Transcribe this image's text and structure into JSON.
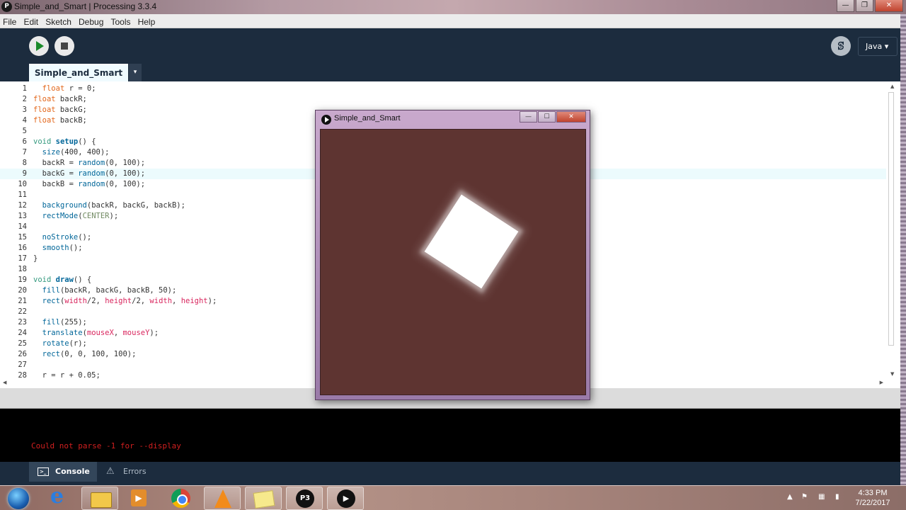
{
  "window": {
    "title": "Simple_and_Smart | Processing 3.3.4"
  },
  "menu": [
    "File",
    "Edit",
    "Sketch",
    "Debug",
    "Tools",
    "Help"
  ],
  "toolbar": {
    "mode": "Java ▾"
  },
  "tab": {
    "name": "Simple_and_Smart",
    "menu_arrow": "▾"
  },
  "editor": {
    "highlighted_line": 9,
    "lines": [
      {
        "n": "1",
        "code": "  float r = 0;"
      },
      {
        "n": "2",
        "code": "float backR;"
      },
      {
        "n": "3",
        "code": "float backG;"
      },
      {
        "n": "4",
        "code": "float backB;"
      },
      {
        "n": "5",
        "code": ""
      },
      {
        "n": "6",
        "code": "void setup() {"
      },
      {
        "n": "7",
        "code": "  size(400, 400);"
      },
      {
        "n": "8",
        "code": "  backR = random(0, 100);"
      },
      {
        "n": "9",
        "code": "  backG = random(0, 100);"
      },
      {
        "n": "10",
        "code": "  backB = random(0, 100);"
      },
      {
        "n": "11",
        "code": ""
      },
      {
        "n": "12",
        "code": "  background(backR, backG, backB);"
      },
      {
        "n": "13",
        "code": "  rectMode(CENTER);"
      },
      {
        "n": "14",
        "code": ""
      },
      {
        "n": "15",
        "code": "  noStroke();"
      },
      {
        "n": "16",
        "code": "  smooth();"
      },
      {
        "n": "17",
        "code": "}"
      },
      {
        "n": "18",
        "code": ""
      },
      {
        "n": "19",
        "code": "void draw() {"
      },
      {
        "n": "20",
        "code": "  fill(backR, backG, backB, 50);"
      },
      {
        "n": "21",
        "code": "  rect(width/2, height/2, width, height);"
      },
      {
        "n": "22",
        "code": ""
      },
      {
        "n": "23",
        "code": "  fill(255);"
      },
      {
        "n": "24",
        "code": "  translate(mouseX, mouseY);"
      },
      {
        "n": "25",
        "code": "  rotate(r);"
      },
      {
        "n": "26",
        "code": "  rect(0, 0, 100, 100);"
      },
      {
        "n": "27",
        "code": ""
      },
      {
        "n": "28",
        "code": "  r = r + 0.05;"
      }
    ]
  },
  "console": {
    "message": "Could not parse -1 for --display"
  },
  "console_tabs": {
    "console": "Console",
    "errors": "Errors"
  },
  "sketch_window": {
    "title": "Simple_and_Smart",
    "background": "#5e3431",
    "square_color": "#ffffff"
  },
  "taskbar": {
    "items": [
      "Start",
      "Internet Explorer",
      "Windows Explorer",
      "Windows Media Player",
      "Google Chrome",
      "VLC media player",
      "Sticky Notes",
      "Processing",
      "Simple_and_Smart"
    ],
    "time": "4:33 PM",
    "date": "7/22/2017"
  },
  "colors": {
    "ide_dark": "#1c2c3e",
    "tab_active": "#f0fbff",
    "console_error": "#d11f1f"
  }
}
